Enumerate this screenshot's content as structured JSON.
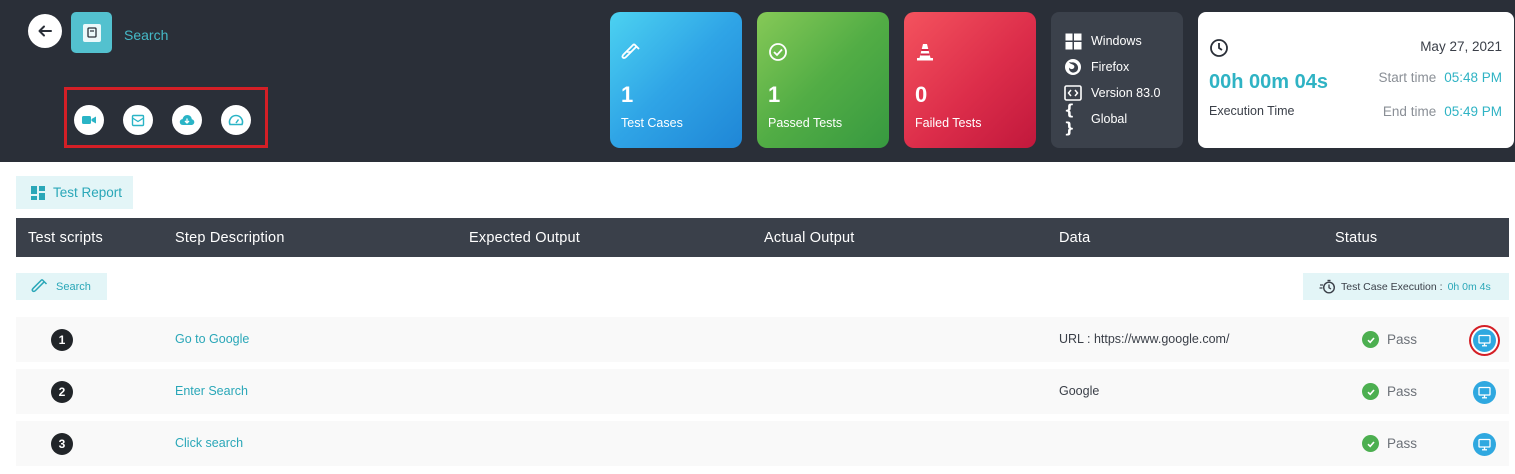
{
  "header": {
    "title": "Search",
    "actions": [
      "video-icon",
      "email-icon",
      "cloud-download-icon",
      "speedometer-icon"
    ]
  },
  "stats": {
    "test_cases": {
      "value": "1",
      "label": "Test Cases"
    },
    "passed": {
      "value": "1",
      "label": "Passed Tests"
    },
    "failed": {
      "value": "0",
      "label": "Failed Tests"
    }
  },
  "environment": {
    "os": "Windows",
    "browser": "Firefox",
    "version": "Version 83.0",
    "region": "Global"
  },
  "timing": {
    "date": "May 27, 2021",
    "execution_time": "00h 00m 04s",
    "execution_label": "Execution Time",
    "start_label": "Start time",
    "start_value": "05:48 PM",
    "end_label": "End time",
    "end_value": "05:49 PM"
  },
  "report_button": "Test Report",
  "table": {
    "columns": [
      "Test scripts",
      "Step Description",
      "Expected Output",
      "Actual Output",
      "Data",
      "Status"
    ],
    "script_name": "Search",
    "execution_label": "Test Case Execution :",
    "execution_value": "0h 0m 4s",
    "rows": [
      {
        "num": "1",
        "step": "Go to Google",
        "data": "URL : https://www.google.com/",
        "status": "Pass"
      },
      {
        "num": "2",
        "step": "Enter Search",
        "data": "Google",
        "status": "Pass"
      },
      {
        "num": "3",
        "step": "Click search",
        "data": "",
        "status": "Pass"
      }
    ]
  },
  "colors": {
    "accent": "#2aa7b8",
    "header_bg": "#2a2f38",
    "pass": "#4caf50",
    "highlight": "#d41f26"
  }
}
